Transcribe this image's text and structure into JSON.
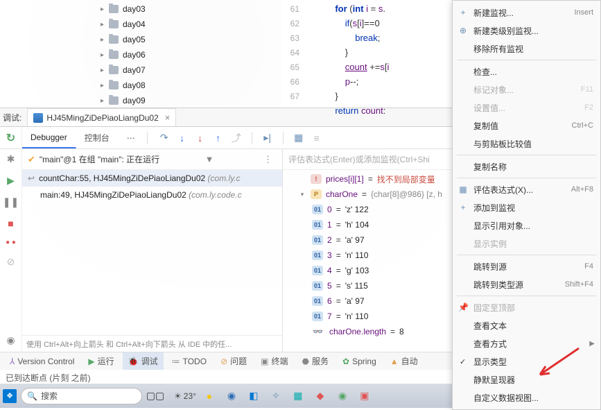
{
  "tree": {
    "items": [
      "day03",
      "day04",
      "day05",
      "day06",
      "day07",
      "day08",
      "day09"
    ]
  },
  "code": {
    "lines": [
      {
        "n": "61",
        "pre": "            ",
        "html": "<span class='kw'>for</span> (<span class='kw'>int</span> <span class='var'>i</span> = <span class='var'>s</span>."
      },
      {
        "n": "62",
        "pre": "                ",
        "html": "<span class='ctrl'>if</span>(<span class='var'>s</span>[<span class='var'>i</span>]==0"
      },
      {
        "n": "63",
        "pre": "                    ",
        "html": "<span class='ctrl'>break</span>;"
      },
      {
        "n": "64",
        "pre": "                ",
        "html": "}"
      },
      {
        "n": "65",
        "pre": "                ",
        "html": "<span class='var' style='text-decoration:underline'>count</span> +=<span class='var'>s</span>[<span class='var'>i</span>"
      },
      {
        "n": "66",
        "pre": "                ",
        "html": "<span class='var'>p</span>--;"
      },
      {
        "n": "67",
        "pre": "            ",
        "html": "}"
      },
      {
        "n": "",
        "pre": "            ",
        "html": "<span class='ctrl'>return</span> <span class='var'>count</span>:"
      }
    ]
  },
  "debug": {
    "label": "调试:",
    "tab_title": "HJ45MingZiDePiaoLiangDu02",
    "tabs": {
      "debugger": "Debugger",
      "console": "控制台"
    },
    "thread_line": "\"main\"@1 在组 \"main\": 正在运行",
    "frames": [
      {
        "sel": true,
        "text": "countChar:55, HJ45MingZiDePiaoLiangDu02",
        "grey": " (com.ly.c"
      },
      {
        "sel": false,
        "text": "main:49, HJ45MingZiDePiaoLiangDu02",
        "grey": " (com.ly.code.c"
      }
    ],
    "hint": "使用 Ctrl+Alt+向上箭头 和 Ctrl+Alt+向下箭头 从 IDE 中的任...",
    "vars_placeholder": "评估表达式(Enter)或添加监视(Ctrl+Shi",
    "vars": {
      "err_name": "prices[i][1]",
      "err_val": "找不到局部变量",
      "charOne_name": "charOne",
      "charOne_val": "{char[8]@986} [z, h",
      "items": [
        {
          "i": "0",
          "v": "'z' 122"
        },
        {
          "i": "1",
          "v": "'h' 104"
        },
        {
          "i": "2",
          "v": "'a' 97"
        },
        {
          "i": "3",
          "v": "'n' 110"
        },
        {
          "i": "4",
          "v": "'g' 103"
        },
        {
          "i": "5",
          "v": "'s' 115"
        },
        {
          "i": "6",
          "v": "'a' 97"
        },
        {
          "i": "7",
          "v": "'n' 110"
        }
      ],
      "len_name": "charOne.length",
      "len_val": "8"
    }
  },
  "bottom": {
    "vc": "Version Control",
    "run": "运行",
    "debug": "调试",
    "todo": "TODO",
    "problems": "问题",
    "terminal": "终端",
    "services": "服务",
    "spring": "Spring",
    "auto": "自动"
  },
  "status": "已到达断点 (片刻 之前)",
  "taskbar": {
    "search": "搜索",
    "temp": "23°"
  },
  "menu": {
    "items": [
      {
        "t": "ic",
        "icon": "+",
        "label": "新建监视...",
        "sc": "Insert"
      },
      {
        "t": "ic",
        "icon": "⊕",
        "label": "新建类级别监视..."
      },
      {
        "t": "",
        "label": "移除所有监视"
      },
      {
        "t": "sep"
      },
      {
        "t": "",
        "label": "检查..."
      },
      {
        "t": "dis",
        "label": "标记对象...",
        "sc": "F11"
      },
      {
        "t": "dis",
        "label": "设置值...",
        "sc": "F2"
      },
      {
        "t": "",
        "label": "复制值",
        "sc": "Ctrl+C"
      },
      {
        "t": "",
        "label": "与剪贴板比较值"
      },
      {
        "t": "sep"
      },
      {
        "t": "",
        "label": "复制名称"
      },
      {
        "t": "sep"
      },
      {
        "t": "ic",
        "icon": "▦",
        "label": "评估表达式(X)...",
        "sc": "Alt+F8"
      },
      {
        "t": "ic",
        "icon": "+",
        "label": "添加到监视"
      },
      {
        "t": "",
        "label": "显示引用对象..."
      },
      {
        "t": "dis",
        "label": "显示实例"
      },
      {
        "t": "sep"
      },
      {
        "t": "",
        "label": "跳转到源",
        "sc": "F4"
      },
      {
        "t": "",
        "label": "跳转到类型源",
        "sc": "Shift+F4"
      },
      {
        "t": "sep"
      },
      {
        "t": "dis",
        "icon": "📌",
        "label": "固定至顶部"
      },
      {
        "t": "",
        "label": "查看文本"
      },
      {
        "t": "sub",
        "label": "查看方式"
      },
      {
        "t": "chk",
        "label": "显示类型"
      },
      {
        "t": "",
        "label": "静默呈现器"
      },
      {
        "t": "",
        "label": "自定义数据视图..."
      }
    ]
  },
  "watermark": "测试时师师"
}
